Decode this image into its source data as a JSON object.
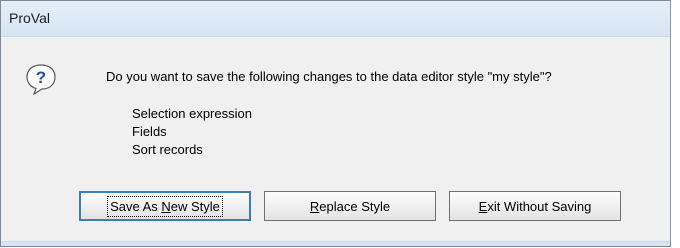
{
  "window": {
    "title": "ProVal"
  },
  "dialog": {
    "message": "Do you want to save the following changes to the data editor style \"my style\"?",
    "icon": "question-icon",
    "changes": [
      "Selection expression",
      "Fields",
      "Sort records"
    ]
  },
  "buttons": {
    "save_new": {
      "prefix": "Save As ",
      "mnemonic": "N",
      "suffix": "ew Style"
    },
    "replace": {
      "prefix": "",
      "mnemonic": "R",
      "suffix": "eplace Style"
    },
    "exit": {
      "prefix": "",
      "mnemonic": "E",
      "suffix": "xit Without Saving"
    }
  },
  "colors": {
    "title_bar": "#d6e4f3",
    "dialog_bg": "#f0f0f0",
    "default_button_border": "#3c7fb1",
    "icon_blue": "#1e4fa0"
  }
}
